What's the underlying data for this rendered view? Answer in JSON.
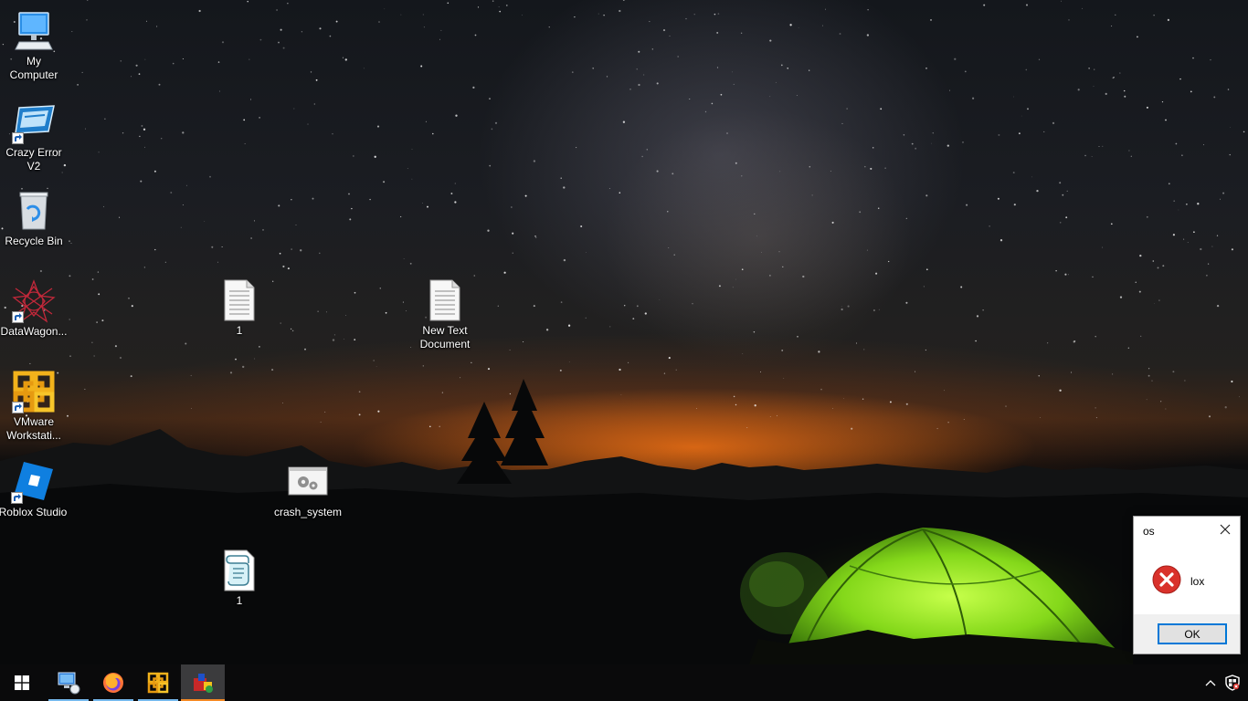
{
  "desktop": {
    "icons": [
      {
        "label": "My\nComputer",
        "icon": "computer-icon",
        "shortcut": false
      },
      {
        "label": "Crazy Error V2",
        "icon": "error-window-icon",
        "shortcut": true
      },
      {
        "label": "Recycle Bin",
        "icon": "recycle-bin-icon",
        "shortcut": false
      },
      {
        "label": "DataWagon...",
        "icon": "datawagon-icon",
        "shortcut": true
      },
      {
        "label": "VMware Workstati...",
        "icon": "vmware-icon",
        "shortcut": true
      },
      {
        "label": "Roblox Studio",
        "icon": "roblox-studio-icon",
        "shortcut": true
      },
      {
        "label": "1",
        "icon": "text-file-icon",
        "shortcut": false
      },
      {
        "label": "New Text Document",
        "icon": "text-file-icon",
        "shortcut": false
      },
      {
        "label": "crash_system",
        "icon": "batch-file-icon",
        "shortcut": false
      },
      {
        "label": "1",
        "icon": "script-file-icon",
        "shortcut": false
      }
    ]
  },
  "dialog": {
    "title": "os",
    "message": "lox",
    "ok_label": "OK",
    "icon": "error-icon"
  },
  "taskbar": {
    "start_icon": "windows-logo-icon",
    "pinned": [
      {
        "icon": "computer-network-icon",
        "running": true
      },
      {
        "icon": "firefox-icon",
        "running": true
      },
      {
        "icon": "vmware-icon",
        "running": true
      },
      {
        "icon": "script-app-icon",
        "running": true,
        "active": true
      }
    ],
    "tray": [
      "chevron-up-icon",
      "windows-security-icon"
    ]
  },
  "colors": {
    "accent": "#0078d7",
    "taskbar": "#0a0a0b",
    "active_indicator": "#f58a24",
    "running_indicator": "#76b9ed",
    "error_red": "#d9312b",
    "tent_green": "#8fe01c"
  }
}
